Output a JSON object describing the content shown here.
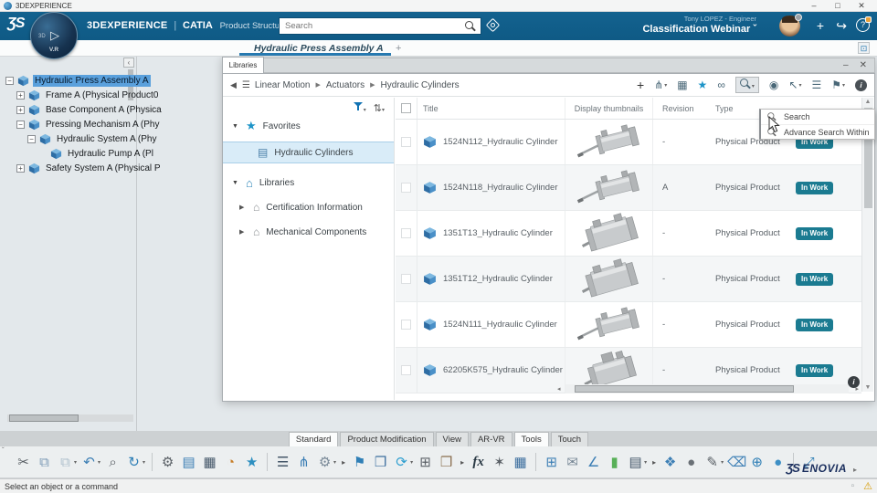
{
  "colors": {
    "brand_blue": "#0f5a85",
    "accent_blue": "#2779b0",
    "badge_teal": "#1b7b91",
    "star_blue": "#1d94c8",
    "selection_blue": "#5aa0dc",
    "warning_yellow": "#d69a00"
  },
  "titlebar": {
    "title": "3DEXPERIENCE",
    "minimize": "–",
    "maximize": "□",
    "close": "✕"
  },
  "appbar": {
    "logo": "ƷS",
    "compass": {
      "dim": "3D",
      "play": "▷",
      "version": "V.R"
    },
    "brand": "3DEXPERIENCE",
    "divider": "|",
    "app": "CATIA",
    "module": "Product Structure Design",
    "search_placeholder": "Search",
    "user": "Tony LOPEZ - Engineer",
    "workspace": "Classification Webinar",
    "caret": "ˇ",
    "add": "+",
    "share": "↪",
    "help": "?"
  },
  "tabrow": {
    "active_tab": "Hydraulic Press Assembly A",
    "add": "+",
    "restore": "⊡"
  },
  "tree": {
    "items": [
      {
        "name": "tree-item-hydraulic-press-assembly",
        "label": "Hydraulic Press Assembly A",
        "level": "lv0",
        "expander": "minus",
        "selected": true
      },
      {
        "name": "tree-item-frame",
        "label": "Frame A (Physical Product0",
        "level": "lv1",
        "expander": "plus",
        "selected": false
      },
      {
        "name": "tree-item-base-component",
        "label": "Base Component A (Physica",
        "level": "lv1",
        "expander": "plus",
        "selected": false
      },
      {
        "name": "tree-item-pressing-mechanism",
        "label": "Pressing Mechanism A (Phy",
        "level": "lv1",
        "expander": "minus",
        "selected": false
      },
      {
        "name": "tree-item-hydraulic-system",
        "label": "Hydraulic System A (Phy",
        "level": "lv2",
        "expander": "minus",
        "selected": false
      },
      {
        "name": "tree-item-hydraulic-pump",
        "label": "Hydraulic Pump A (Pl",
        "level": "lv3",
        "expander": "none",
        "selected": false
      },
      {
        "name": "tree-item-safety-system",
        "label": "Safety System A (Physical P",
        "level": "lv1",
        "expander": "plus",
        "selected": false
      }
    ]
  },
  "libraries_panel": {
    "tab": "Libraries",
    "minimize": "–",
    "close": "✕",
    "breadcrumb": {
      "back": "◀",
      "menu": "☰",
      "sep": "▶",
      "crumbs": [
        {
          "label": "Linear Motion"
        },
        {
          "label": "Actuators"
        },
        {
          "label": "Hydraulic Cylinders"
        }
      ]
    },
    "toolbar": {
      "add": "+",
      "structure": "⋔",
      "new_table": "▦",
      "favorite": "★",
      "link": "∞",
      "people": "◉",
      "cursor": "↖",
      "list": "☰",
      "filter": "⚑",
      "info": "i",
      "dd": "▾"
    },
    "nav": {
      "expanded": "▼",
      "collapsed": "▶",
      "star": "★",
      "library_icon": "⌂",
      "item_icon": "▤",
      "sort": "⇅",
      "favorites": "Favorites",
      "favorite_items": [
        {
          "label": "Hydraulic Cylinders"
        }
      ],
      "libraries": "Libraries",
      "items": [
        {
          "label": "Certification Information"
        },
        {
          "label": "Mechanical Components"
        }
      ]
    },
    "table": {
      "headers": {
        "title": "Title",
        "thumb": "Display thumbnails",
        "revision": "Revision",
        "type": "Type"
      },
      "rows": [
        {
          "title": "1524N112_Hydraulic Cylinder",
          "revision": "-",
          "type": "Physical Product",
          "status": "In Work",
          "thumb": "rod"
        },
        {
          "title": "1524N118_Hydraulic Cylinder",
          "revision": "A",
          "type": "Physical Product",
          "status": "In Work",
          "thumb": "rod"
        },
        {
          "title": "1351T13_Hydraulic Cylinder",
          "revision": "-",
          "type": "Physical Product",
          "status": "In Work",
          "thumb": "block"
        },
        {
          "title": "1351T12_Hydraulic Cylinder",
          "revision": "-",
          "type": "Physical Product",
          "status": "In Work",
          "thumb": "block"
        },
        {
          "title": "1524N111_Hydraulic Cylinder",
          "revision": "-",
          "type": "Physical Product",
          "status": "In Work",
          "thumb": "rod"
        },
        {
          "title": "62205K575_Hydraulic Cylinder",
          "revision": "-",
          "type": "Physical Product",
          "status": "In Work",
          "thumb": "compact"
        }
      ]
    },
    "search_menu": {
      "items": [
        {
          "label": "Search"
        },
        {
          "label": "Advance Search Within"
        }
      ]
    },
    "scroll": {
      "up": "▲",
      "down": "▼",
      "left": "◂",
      "right": "▸"
    }
  },
  "ribbon": {
    "collapse": "ˇ",
    "dd": "▾",
    "expand": "▸",
    "tabs": [
      {
        "name": "ribbon-tab-standard",
        "label": "Standard",
        "active": true
      },
      {
        "name": "ribbon-tab-product-modification",
        "label": "Product Modification",
        "active": false
      },
      {
        "name": "ribbon-tab-view",
        "label": "View",
        "active": false
      },
      {
        "name": "ribbon-tab-ar-vr",
        "label": "AR-VR",
        "active": false
      },
      {
        "name": "ribbon-tab-tools",
        "label": "Tools",
        "active": true
      },
      {
        "name": "ribbon-tab-touch",
        "label": "Touch",
        "active": false
      }
    ],
    "icons": [
      {
        "name": "cut-icon",
        "glyph": "✂",
        "color": "#5a6066"
      },
      {
        "name": "copy-icon",
        "glyph": "⧉",
        "color": "#7a98b5"
      },
      {
        "name": "paste-icon",
        "glyph": "⧉",
        "color": "#aebfcc",
        "dd": true
      },
      {
        "name": "undo-icon",
        "glyph": "↶",
        "color": "#3d7fb5",
        "dd": true
      },
      {
        "name": "zoom-icon",
        "glyph": "⌕",
        "color": "#5a6066"
      },
      {
        "name": "update-icon",
        "glyph": "↻",
        "color": "#2f7fb6",
        "dd": true,
        "sep_after": true
      },
      {
        "name": "session-drive-icon",
        "glyph": "⚙",
        "color": "#5a6066"
      },
      {
        "name": "list-select-icon",
        "glyph": "▤",
        "color": "#3d7fb5"
      },
      {
        "name": "spreadsheet-icon",
        "glyph": "▦",
        "color": "#46586a"
      },
      {
        "name": "report-chart-icon",
        "glyph": "◔",
        "color": "#c77f2a"
      },
      {
        "name": "favorites-star-icon",
        "glyph": "★",
        "color": "#2d8fc0",
        "sep_after": true
      },
      {
        "name": "list-icon",
        "glyph": "☰",
        "color": "#46586a"
      },
      {
        "name": "relations-icon",
        "glyph": "⋔",
        "color": "#3d7fb5"
      },
      {
        "name": "settings-screen-icon",
        "glyph": "⚙",
        "color": "#7a8a98",
        "dd": true,
        "expand_after": true
      },
      {
        "name": "structure-flag-icon",
        "glyph": "⚑",
        "color": "#2f7fb6"
      },
      {
        "name": "layers-icon",
        "glyph": "❒",
        "color": "#3d6f9f"
      },
      {
        "name": "sync-icon",
        "glyph": "⟳",
        "color": "#2f9fd0",
        "dd": true
      },
      {
        "name": "select-structure-icon",
        "glyph": "⊞",
        "color": "#5a6066"
      },
      {
        "name": "catalog-book-icon",
        "glyph": "❒",
        "color": "#8a6f4f",
        "expand_after": true
      },
      {
        "name": "formula-icon",
        "glyph": "fx",
        "color": "#2b3a45",
        "style_class": "it"
      },
      {
        "name": "wand-icon",
        "glyph": "✶",
        "color": "#5a6066"
      },
      {
        "name": "design-grid-icon",
        "glyph": "▦",
        "color": "#3d6f9f",
        "sep_after": true
      },
      {
        "name": "design-table-icon",
        "glyph": "⊞",
        "color": "#3d7fb5"
      },
      {
        "name": "mail-gear-icon",
        "glyph": "✉",
        "color": "#7a8a98"
      },
      {
        "name": "measure-icon",
        "glyph": "∠",
        "color": "#3d7fb5"
      },
      {
        "name": "traffic-light-icon",
        "glyph": "▮",
        "color": "#58b058"
      },
      {
        "name": "equalizer-icon",
        "glyph": "▤",
        "color": "#46586a",
        "dd": true,
        "expand_after": true
      },
      {
        "name": "material-icon",
        "glyph": "❖",
        "color": "#3d7fb5"
      },
      {
        "name": "shaded-sphere-icon",
        "glyph": "●",
        "color": "#6a7076"
      },
      {
        "name": "picker-pen-icon",
        "glyph": "✎",
        "color": "#5a6066",
        "dd": true
      },
      {
        "name": "eraser-icon",
        "glyph": "⌫",
        "color": "#3d7fb5"
      },
      {
        "name": "sphere-add-icon",
        "glyph": "⊕",
        "color": "#2f7fb6"
      },
      {
        "name": "sphere-blue-icon",
        "glyph": "●",
        "color": "#3d8fc5",
        "sep_after": true
      },
      {
        "name": "expand-all-icon",
        "glyph": "⤢",
        "color": "#2f7fb6"
      }
    ]
  },
  "footer": {
    "status": "Select an object or a command",
    "logo_mark": "ƷS",
    "logo": "ENOVIA",
    "expand": "▸",
    "panel_icon": "▫",
    "warning": "⚠"
  }
}
